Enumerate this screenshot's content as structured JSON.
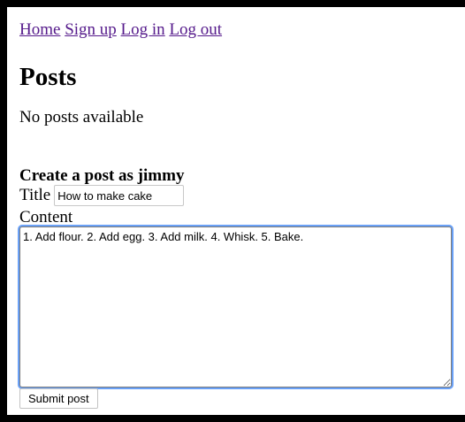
{
  "nav": {
    "items": [
      {
        "label": "Home"
      },
      {
        "label": "Sign up"
      },
      {
        "label": "Log in"
      },
      {
        "label": "Log out"
      }
    ]
  },
  "posts": {
    "heading": "Posts",
    "empty_message": "No posts available"
  },
  "create_post": {
    "heading": "Create a post as jimmy",
    "title_label": "Title",
    "title_value": "How to make cake",
    "content_label": "Content",
    "content_value": "1. Add flour. 2. Add egg. 3. Add milk. 4. Whisk. 5. Bake.",
    "submit_label": "Submit post"
  },
  "colors": {
    "link": "#551a8b",
    "focus_ring": "#6aa1f7",
    "frame": "#000000"
  }
}
